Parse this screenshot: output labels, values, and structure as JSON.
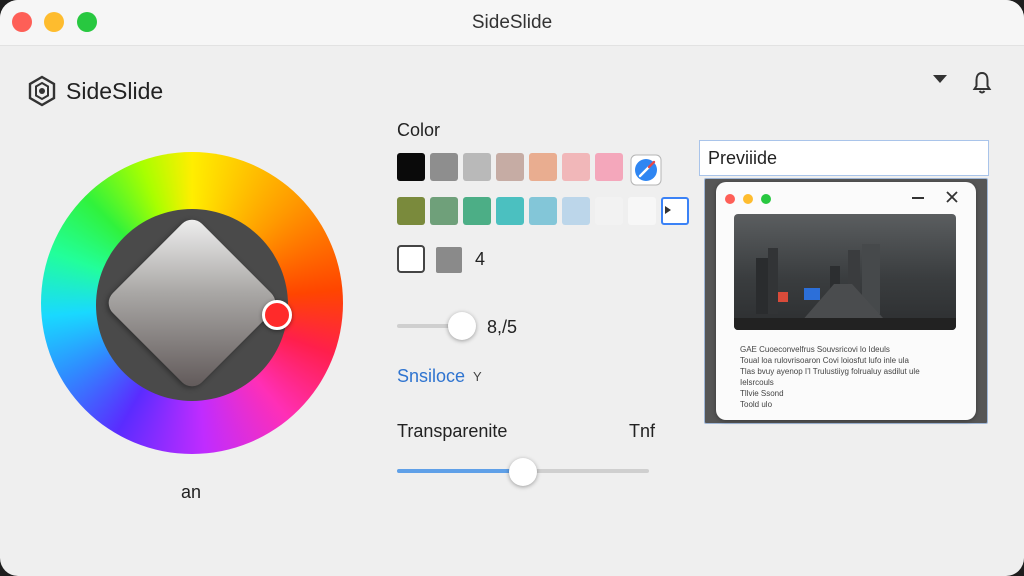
{
  "window": {
    "title": "SideSlide"
  },
  "brand": {
    "name": "SideSlide",
    "icon": "hexagon-logo-icon"
  },
  "header": {
    "menu_icon": "dropdown-arrow-icon",
    "notification_icon": "bell-icon"
  },
  "color_wheel": {
    "label": "an"
  },
  "color": {
    "label": "Color",
    "row1": [
      "#0a0a0a",
      "#8e8e8e",
      "#b9b9b9",
      "#c6aca4",
      "#e9ad90",
      "#f1b7b9",
      "#f4a7bb"
    ],
    "row2": [
      "#7a8a3c",
      "#6fa07a",
      "#4cae86",
      "#4bc0c0",
      "#83c6d8",
      "#bcd6ea",
      "#f2f2f2",
      "#f7f7f7",
      "#ffffff"
    ],
    "picker_icon": "eyedropper-icon",
    "count_value": "4"
  },
  "size_slider": {
    "value_text": "8,/5",
    "level": 0.73
  },
  "source": {
    "label": "Snsiloce",
    "chevron": "Y"
  },
  "transparency": {
    "label": "Transparenite",
    "value_text": "Tnf",
    "level": 0.5
  },
  "preview": {
    "field_value": "Previiide",
    "mini_window": {
      "lines": [
        "GAE Cuoeconvelfrus Souvsricovi lo Ideuls",
        "Toual loa rulovrisoaron Covi loiosfut lufo inle ula",
        "Tlas bvuy ayenop I’l Trulustiiyg folrualuy asdilut ule",
        "Ielsrcouls",
        "Tllvie Ssond",
        "Toold ulo"
      ]
    }
  }
}
